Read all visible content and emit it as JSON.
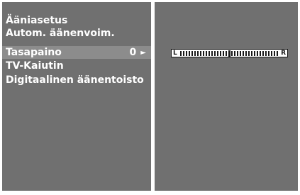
{
  "menu": {
    "items": [
      {
        "label": "Ääniasetus"
      },
      {
        "label": "Autom. äänenvoim."
      },
      {
        "label": "Tasapaino",
        "value": "0",
        "arrow": "►",
        "selected": true
      },
      {
        "label": "TV-Kaiutin"
      },
      {
        "label": "Digitaalinen äänentoisto"
      }
    ]
  },
  "balance": {
    "left_label": "L",
    "right_label": "R",
    "value": 0
  },
  "colors": {
    "panel": "#707070",
    "selected_row": "#8c8c8c",
    "text": "#ffffff",
    "frame": "#ffffff"
  }
}
